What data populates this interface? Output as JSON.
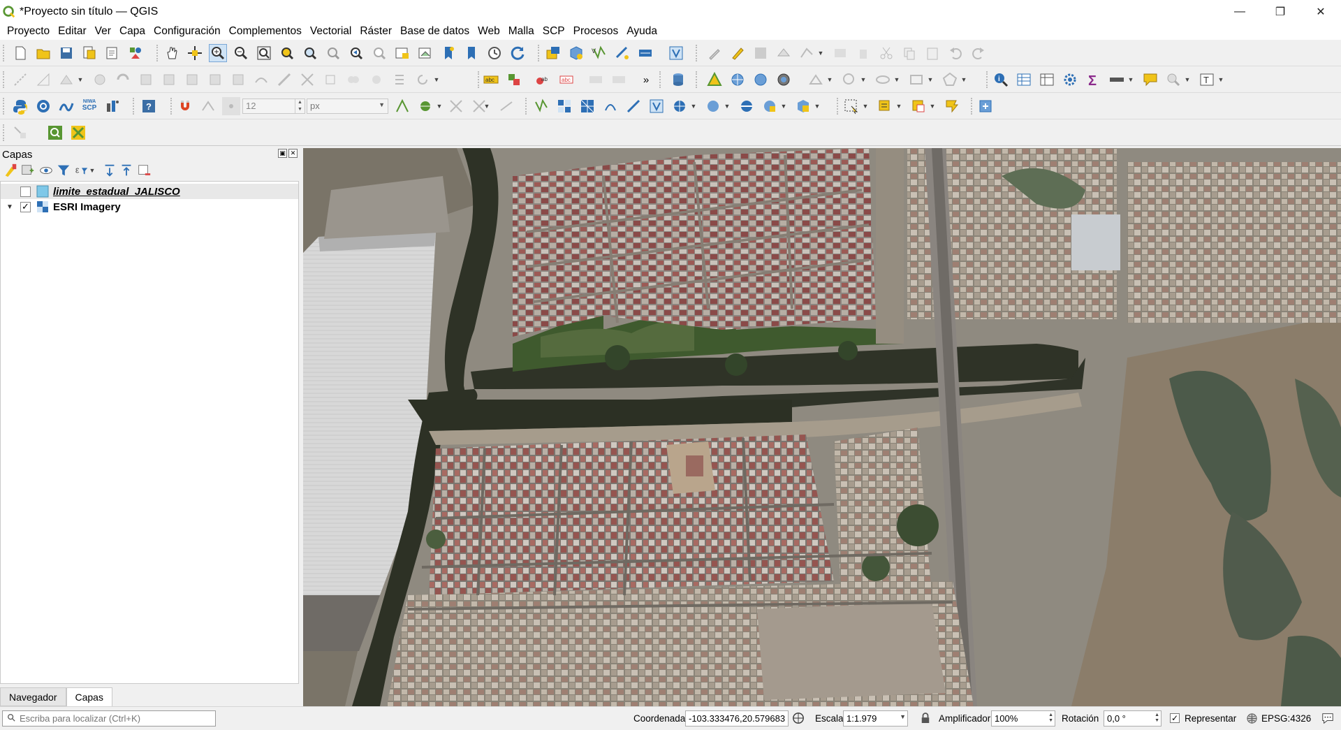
{
  "window": {
    "title": "*Proyecto sin título — QGIS",
    "minimize": "—",
    "restore": "❐",
    "close": "✕"
  },
  "menu": {
    "items": [
      "Proyecto",
      "Editar",
      "Ver",
      "Capa",
      "Configuración",
      "Complementos",
      "Vectorial",
      "Ráster",
      "Base de datos",
      "Web",
      "Malla",
      "SCP",
      "Procesos",
      "Ayuda"
    ]
  },
  "toolbar": {
    "snapping_tolerance": "12",
    "snapping_units": "px",
    "more_label": "»",
    "scp_label": "SCP",
    "niwa_label": "NIWA"
  },
  "layers_panel": {
    "title": "Capas",
    "layers": [
      {
        "name": "limite_estadual_JALISCO",
        "checked": false,
        "type": "vector-polygon"
      },
      {
        "name": "ESRI Imagery",
        "checked": true,
        "type": "raster"
      }
    ],
    "tabs": [
      "Navegador",
      "Capas"
    ],
    "active_tab": "Capas"
  },
  "statusbar": {
    "locator_placeholder": "Escriba para localizar (Ctrl+K)",
    "coordinate_label": "Coordenada",
    "coordinate_value": "-103.333476,20.579683",
    "scale_label": "Escala",
    "scale_value": "1:1.979",
    "magnifier_label": "Amplificador",
    "magnifier_value": "100%",
    "rotation_label": "Rotación",
    "rotation_value": "0,0 °",
    "render_label": "Representar",
    "render_checked": true,
    "crs": "EPSG:4326"
  },
  "colors": {
    "qgis_green": "#589632",
    "accent_yellow": "#f0c419",
    "accent_blue": "#2d6fb5"
  },
  "map": {
    "layer": "ESRI Imagery"
  }
}
